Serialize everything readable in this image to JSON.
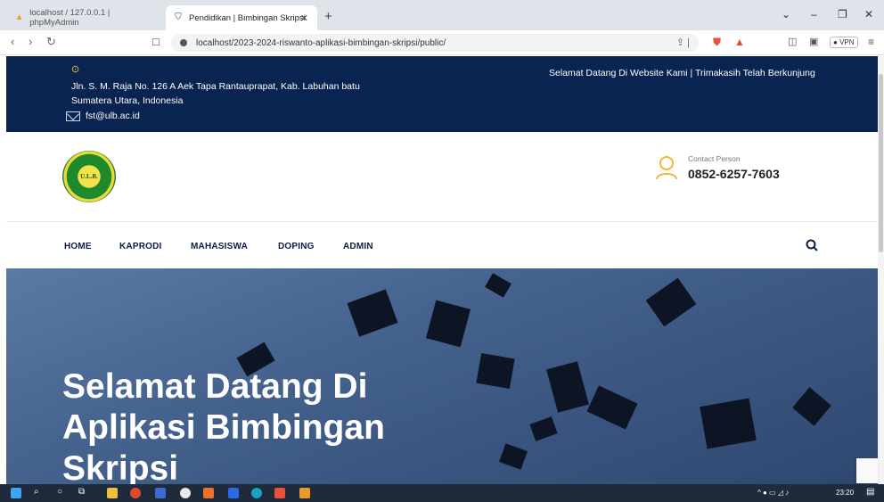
{
  "browser": {
    "tabs": [
      {
        "title": "localhost / 127.0.0.1 | phpMyAdmin"
      },
      {
        "title": "Pendidikan | Bimbingan Skripsi"
      }
    ],
    "new_tab": "+",
    "url": "localhost/2023-2024-riswanto-aplikasi-bimbingan-skripsi/public/",
    "vpn_label": "VPN"
  },
  "topbar": {
    "address_line1": "Jln. S. M. Raja No. 126 A Aek Tapa Rantauprapat, Kab. Labuhan batu",
    "address_line2": "Sumatera Utara, Indonesia",
    "email": "fst@ulb.ac.id",
    "welcome": "Selamat Datang Di Website Kami | Trimakasih Telah Berkunjung"
  },
  "header": {
    "logo_text": "U.L.B.",
    "contact_label": "Contact Person",
    "contact_phone": "0852-6257-7603"
  },
  "menu": {
    "items": [
      "HOME",
      "KAPRODI",
      "MAHASISWA",
      "DOPING",
      "ADMIN"
    ]
  },
  "hero": {
    "line1": "Selamat Datang Di",
    "line2": "Aplikasi Bimbingan",
    "line3": "Skripsi"
  },
  "taskbar": {
    "time": "23:20"
  },
  "colors": {
    "topbar_bg": "#0a2451",
    "accent": "#f4c13a",
    "menu_text": "#0a1e3f"
  },
  "icons": [
    "map-pin-icon",
    "mail-icon",
    "contact-person-icon",
    "search-icon"
  ]
}
